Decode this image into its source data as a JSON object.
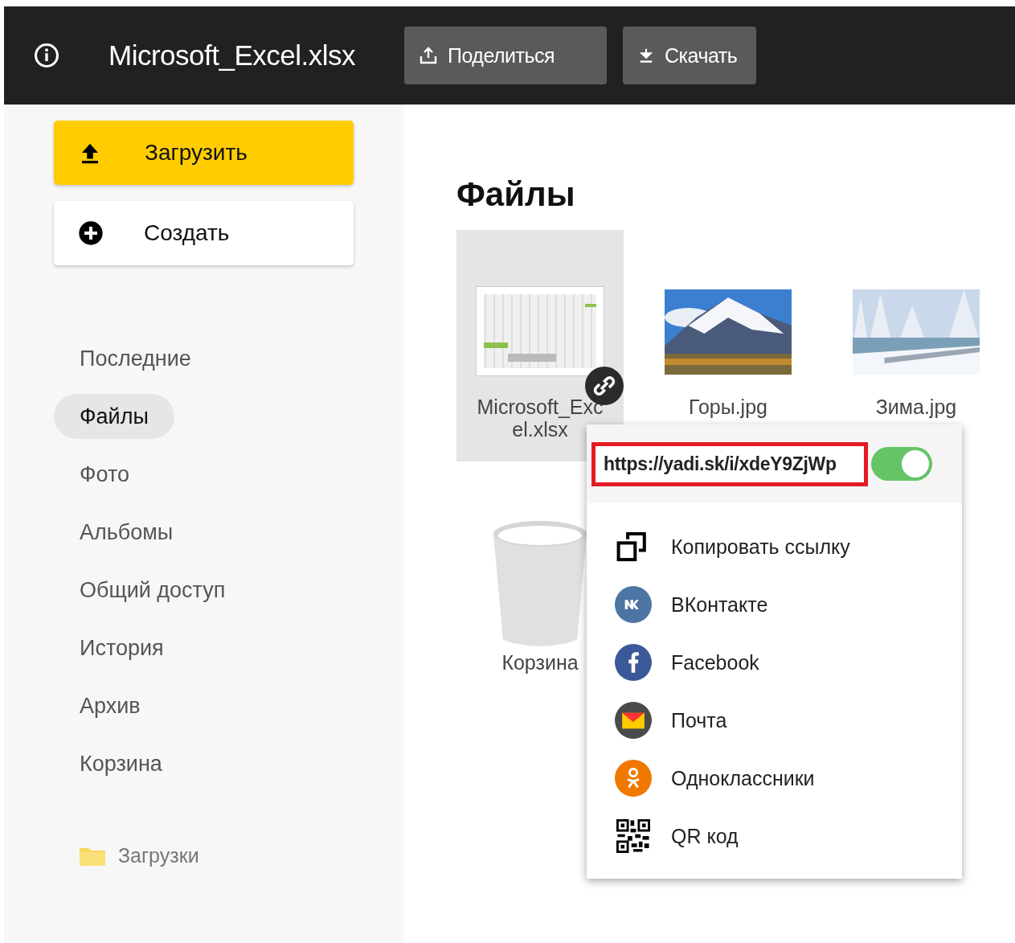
{
  "header": {
    "title": "Microsoft_Excel.xlsx",
    "buttons": [
      {
        "kind": "share",
        "label": "Поделиться"
      },
      {
        "kind": "download",
        "label": "Скачать"
      }
    ]
  },
  "sidebar": {
    "actions": [
      {
        "kind": "upload",
        "label": "Загрузить"
      },
      {
        "kind": "create",
        "label": "Создать"
      }
    ],
    "items": [
      {
        "label": "Последние",
        "selected": false
      },
      {
        "label": "Файлы",
        "selected": true
      },
      {
        "label": "Фото",
        "selected": false
      },
      {
        "label": "Альбомы",
        "selected": false
      },
      {
        "label": "Общий доступ",
        "selected": false
      },
      {
        "label": "История",
        "selected": false
      },
      {
        "label": "Архив",
        "selected": false
      },
      {
        "label": "Корзина",
        "selected": false
      }
    ],
    "folders": [
      {
        "label": "Загрузки"
      }
    ]
  },
  "main": {
    "heading": "Файлы",
    "files": [
      {
        "kind": "spreadsheet",
        "name": "Microsoft_Excel.xlsx",
        "selected": true,
        "shared": true
      },
      {
        "name": "Горы.jpg",
        "selected": false,
        "shared": false
      },
      {
        "name": "Зима.jpg",
        "selected": false,
        "shared": false
      },
      {
        "kind": "trash",
        "name": "Корзина",
        "selected": false,
        "shared": false
      }
    ]
  },
  "share_popup": {
    "url": "https://yadi.sk/i/xdeY9ZjWp",
    "link_on": true,
    "options": [
      {
        "kind": "copy",
        "label": "Копировать ссылку"
      },
      {
        "kind": "vk",
        "label": "ВКонтакте"
      },
      {
        "kind": "facebook",
        "label": "Facebook"
      },
      {
        "kind": "mail",
        "label": "Почта"
      },
      {
        "kind": "ok",
        "label": "Одноклассники"
      },
      {
        "kind": "qr",
        "label": "QR код"
      }
    ]
  }
}
